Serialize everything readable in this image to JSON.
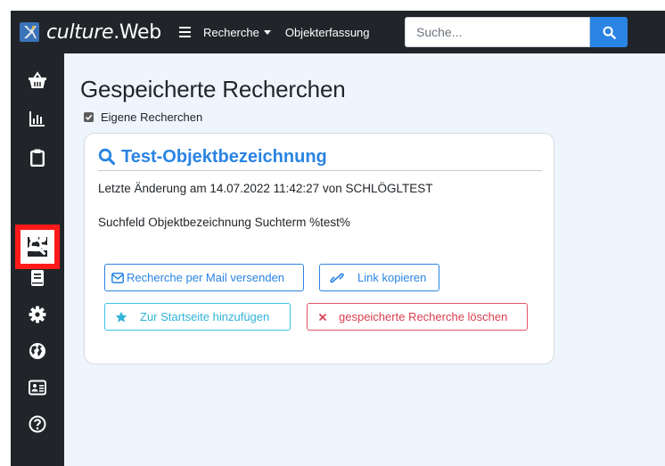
{
  "app": {
    "brand_italic": "culture",
    "brand_rest": ".Web"
  },
  "nav": {
    "recherche_label": "Recherche",
    "objekterfassung_label": "Objekterfassung",
    "search_placeholder": "Suche..."
  },
  "page": {
    "title": "Gespeicherte Recherchen",
    "own_searches_label": "Eigene Recherchen",
    "own_searches_checked": true
  },
  "card": {
    "title": "Test-Objektbezeichnung",
    "meta": "Letzte Änderung am 14.07.2022 11:42:27 von SCHLÖGLTEST",
    "description": "Suchfeld Objektbezeichnung Suchterm %test%",
    "buttons": {
      "mail": "Recherche per Mail versenden",
      "copy_link": "Link kopieren",
      "startpage": "Zur Startseite hinzufügen",
      "delete": "gespeicherte Recherche löschen"
    }
  },
  "sidebar": {
    "items": [
      {
        "icon": "basket-icon"
      },
      {
        "icon": "chart-icon"
      },
      {
        "icon": "clipboard-icon"
      },
      {
        "icon": "search-icon",
        "highlighted": true
      },
      {
        "icon": "users-icon"
      },
      {
        "icon": "book-icon"
      },
      {
        "icon": "gear-icon"
      },
      {
        "icon": "globe-icon"
      },
      {
        "icon": "id-card-icon"
      },
      {
        "icon": "question-icon"
      }
    ]
  },
  "colors": {
    "navbar": "#212529",
    "accent": "#2a84e3",
    "info": "#3ec3e8",
    "danger": "#e05563",
    "highlight": "#ff1a1a",
    "main_bg": "#eef5fd"
  }
}
